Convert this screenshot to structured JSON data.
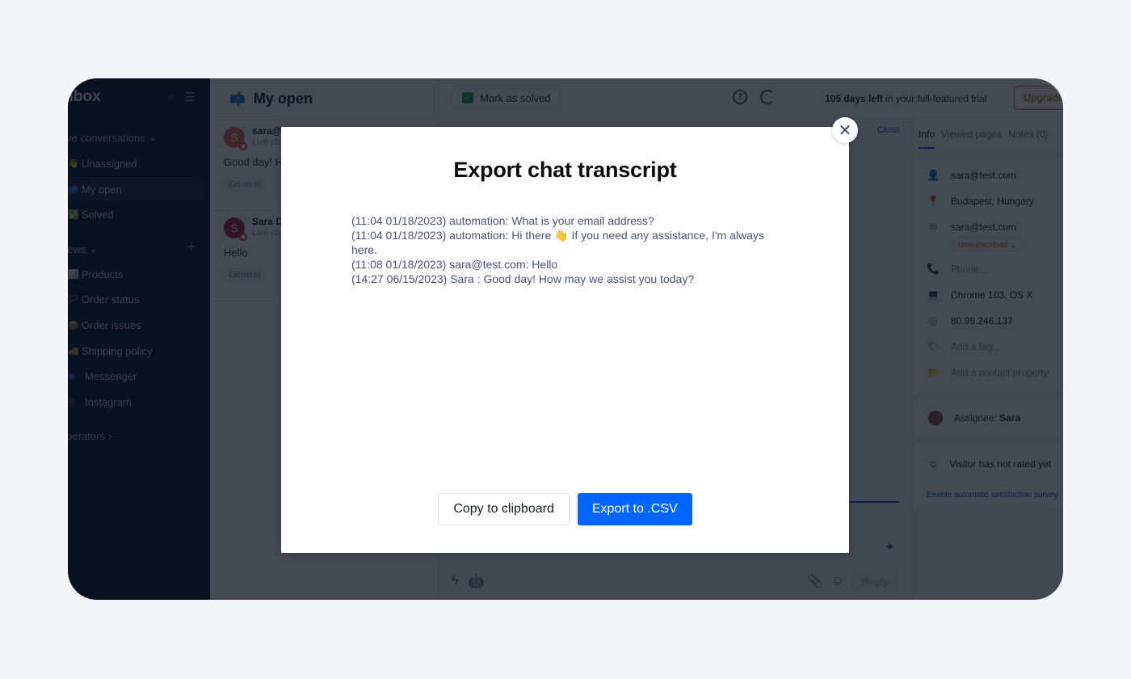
{
  "sidebar": {
    "title": "Inbox",
    "section_live": "Live conversations",
    "items": [
      {
        "icon": "wave-icon",
        "glyph": "👋",
        "label": "Unassigned"
      },
      {
        "icon": "mailbox-icon",
        "glyph": "📫",
        "label": "My open",
        "active": true
      },
      {
        "icon": "check-icon",
        "glyph": "✅",
        "label": "Solved"
      }
    ],
    "section_views": "Views",
    "views": [
      {
        "icon": "products-icon",
        "glyph": "📊",
        "label": "Products"
      },
      {
        "icon": "flag-icon",
        "glyph": "🏳",
        "label": "Order status"
      },
      {
        "icon": "box-icon",
        "glyph": "📦",
        "label": "Order issues"
      },
      {
        "icon": "truck-icon",
        "glyph": "🚚",
        "label": "Shipping policy"
      },
      {
        "icon": "messenger-icon",
        "glyph": "◉",
        "label": "Messenger"
      },
      {
        "icon": "instagram-icon",
        "glyph": "◎",
        "label": "Instagram"
      }
    ],
    "section_operators": "Operators"
  },
  "conversation_list": {
    "title": "My open",
    "conversations": [
      {
        "avatar": "S",
        "avatar_color": "#e06a5e",
        "name": "sara@test.com",
        "channel": "Live chat",
        "message": "Good day! How may we assist you today?",
        "tag": "General"
      },
      {
        "avatar": "S",
        "avatar_color": "#b0245a",
        "name": "Sara D",
        "channel": "Live chat",
        "message": "Hello",
        "tag": "General"
      }
    ]
  },
  "chat": {
    "mark_solved_label": "Mark as solved",
    "help_icon": "?",
    "close_label": "Close",
    "reply_label": "Reply"
  },
  "right_panel": {
    "trial_days": "105 days left",
    "trial_rest": "in your full-featured trial",
    "upgrade_label": "Upgrade",
    "tabs": [
      "Info",
      "Viewed pages",
      "Notes (0)"
    ],
    "info": [
      {
        "icon": "contact-icon",
        "glyph": "👤",
        "value": "sara@test.com",
        "muted": false
      },
      {
        "icon": "location-icon",
        "glyph": "📍",
        "value": "Budapest, Hungary",
        "muted": false
      },
      {
        "icon": "email-icon",
        "glyph": "✉",
        "value": "sara@test.com",
        "muted": false
      },
      {
        "icon": "phone-icon",
        "glyph": "📞",
        "value": "Phone...",
        "muted": true
      },
      {
        "icon": "laptop-icon",
        "glyph": "💻",
        "value": "Chrome 103, OS X",
        "muted": false
      },
      {
        "icon": "ip-icon",
        "glyph": "◎",
        "value": "80.99.246.137",
        "muted": false
      },
      {
        "icon": "tag-icon",
        "glyph": "🏷",
        "value": "Add a tag...",
        "muted": true
      },
      {
        "icon": "folder-icon",
        "glyph": "📁",
        "value": "Add a contact property",
        "muted": true
      }
    ],
    "unsubscribed_label": "Unsubscribed",
    "assignee_label": "Assignee:",
    "assignee_name": "Sara",
    "rating_text": "Visitor has not rated yet",
    "survey_link": "Enable automatic satisfaction survey"
  },
  "modal": {
    "title": "Export chat transcript",
    "transcript": [
      "(11:04 01/18/2023) automation: What is your email address?",
      "(11:04 01/18/2023) automation: Hi there 👋 If you need any assistance, I'm always here.",
      "(11:08 01/18/2023) sara@test.com: Hello",
      "(14:27 06/15/2023) Sara : Good day! How may we assist you today?"
    ],
    "copy_label": "Copy to clipboard",
    "export_label": "Export to .CSV",
    "close_glyph": "✕"
  }
}
